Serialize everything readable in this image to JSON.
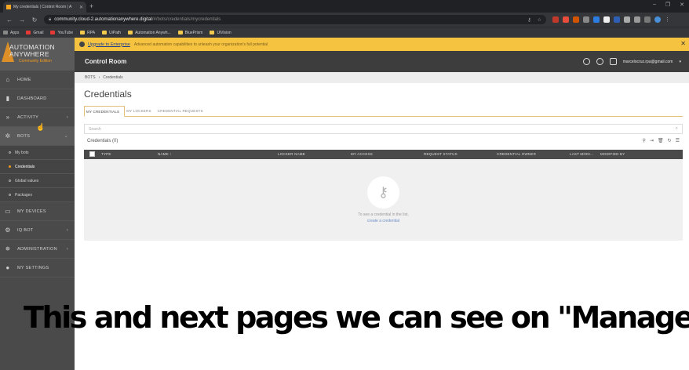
{
  "browser": {
    "tab_title": "My credentials | Control Room | A",
    "url_host": "community.cloud-2.automationanywhere.digital",
    "url_path": "/#/bots/credentials/mycredentials",
    "bookmarks": [
      "Apps",
      "Gmail",
      "YouTube",
      "RPA",
      "UiPath",
      "Automation Anywh...",
      "BluePrism",
      "UiVision"
    ]
  },
  "brand": {
    "line1": "AUTOMATION",
    "line2": "ANYWHERE",
    "line3": "Community Edition",
    "accent": "#f39a1e"
  },
  "sidebar": {
    "items": [
      {
        "label": "HOME",
        "icon": "home-icon"
      },
      {
        "label": "DASHBOARD",
        "icon": "dashboard-icon"
      },
      {
        "label": "ACTIVITY",
        "icon": "activity-icon"
      },
      {
        "label": "BOTS",
        "icon": "bots-icon"
      }
    ],
    "bots_sub": [
      "My bots",
      "Credentials",
      "Global values",
      "Packages"
    ],
    "items2": [
      {
        "label": "MY DEVICES",
        "icon": "devices-icon"
      },
      {
        "label": "IQ BOT",
        "icon": "iqbot-icon"
      },
      {
        "label": "ADMINISTRATION",
        "icon": "admin-icon"
      },
      {
        "label": "MY SETTINGS",
        "icon": "user-icon"
      }
    ]
  },
  "banner": {
    "link": "Upgrade to Enterprise",
    "text": "Advanced automation capabilities to unleash your organization's full potential"
  },
  "header": {
    "title": "Control Room",
    "user": "marcelocruz.rpa@gmail.com"
  },
  "breadcrumb": {
    "root": "BOTS",
    "sep": "›",
    "current": "Credentials"
  },
  "page": {
    "title": "Credentials",
    "tabs": [
      "MY CREDENTIALS",
      "MY LOCKERS",
      "CREDENTIAL REQUESTS"
    ],
    "search_placeholder": "Search",
    "count_label": "Credentials (0)",
    "columns": [
      "TYPE",
      "NAME ↑",
      "LOCKER NAME",
      "MY ACCESS",
      "REQUEST STATUS",
      "CREDENTIAL OWNER",
      "LAST MODI...",
      "MODIFIED BY"
    ],
    "empty_line1": "To see a credential in the list,",
    "empty_line2": "create a credential"
  },
  "caption": "This and next pages we can see on \"Manage\""
}
